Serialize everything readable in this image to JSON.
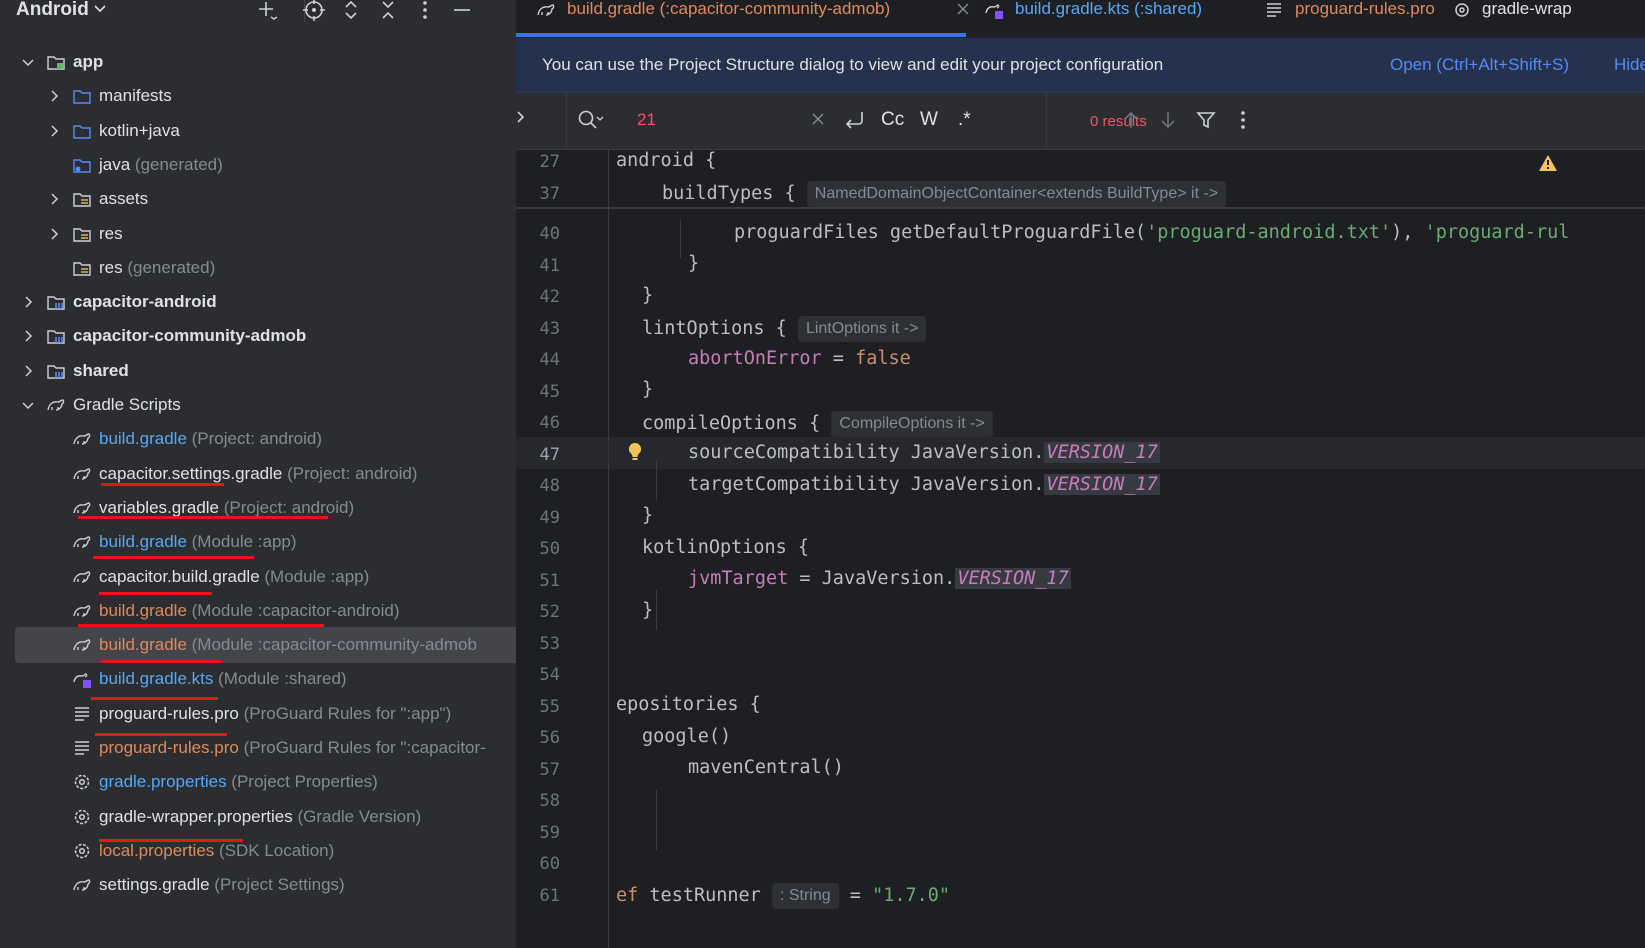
{
  "sidebar": {
    "title": "Android",
    "tree": [
      {
        "label": "app",
        "hint": "",
        "color": "default",
        "bold": true,
        "chevron": "down",
        "icon": "module-folder-icon"
      },
      {
        "label": "manifests",
        "hint": "",
        "color": "default",
        "bold": false,
        "chevron": "right",
        "icon": "folder-icon"
      },
      {
        "label": "kotlin+java",
        "hint": "",
        "color": "default",
        "bold": false,
        "chevron": "right",
        "icon": "folder-icon"
      },
      {
        "label": "java",
        "hint": " (generated)",
        "color": "default",
        "bold": false,
        "chevron": "",
        "icon": "generated-folder-icon"
      },
      {
        "label": "assets",
        "hint": "",
        "color": "default",
        "bold": false,
        "chevron": "right",
        "icon": "resource-folder-icon"
      },
      {
        "label": "res",
        "hint": "",
        "color": "default",
        "bold": false,
        "chevron": "right",
        "icon": "resource-folder-icon"
      },
      {
        "label": "res",
        "hint": " (generated)",
        "color": "default",
        "bold": false,
        "chevron": "",
        "icon": "resource-folder-icon"
      },
      {
        "label": "capacitor-android",
        "hint": "",
        "color": "default",
        "bold": true,
        "chevron": "right",
        "icon": "library-module-icon"
      },
      {
        "label": "capacitor-community-admob",
        "hint": "",
        "color": "default",
        "bold": true,
        "chevron": "right",
        "icon": "library-module-icon"
      },
      {
        "label": "shared",
        "hint": "",
        "color": "default",
        "bold": true,
        "chevron": "right",
        "icon": "library-module-icon"
      },
      {
        "label": "Gradle Scripts",
        "hint": "",
        "color": "default",
        "bold": false,
        "chevron": "down",
        "icon": "gradle-icon"
      },
      {
        "label": "build.gradle",
        "hint": " (Project: android)",
        "color": "blue",
        "bold": false,
        "chevron": "",
        "icon": "gradle-icon"
      },
      {
        "label": "capacitor.settings.gradle",
        "hint": " (Project: android)",
        "color": "default",
        "bold": false,
        "chevron": "",
        "icon": "gradle-icon"
      },
      {
        "label": "variables.gradle",
        "hint": " (Project: android)",
        "color": "default",
        "bold": false,
        "chevron": "",
        "icon": "gradle-icon"
      },
      {
        "label": "build.gradle",
        "hint": " (Module :app)",
        "color": "blue",
        "bold": false,
        "chevron": "",
        "icon": "gradle-icon"
      },
      {
        "label": "capacitor.build.gradle",
        "hint": " (Module :app)",
        "color": "default",
        "bold": false,
        "chevron": "",
        "icon": "gradle-icon"
      },
      {
        "label": "build.gradle",
        "hint": " (Module :capacitor-android)",
        "color": "orange",
        "bold": false,
        "chevron": "",
        "icon": "gradle-icon"
      },
      {
        "label": "build.gradle",
        "hint": " (Module :capacitor-community-admob",
        "color": "orange",
        "bold": false,
        "chevron": "",
        "icon": "gradle-icon",
        "selected": true
      },
      {
        "label": "build.gradle.kts",
        "hint": " (Module :shared)",
        "color": "blue",
        "bold": false,
        "chevron": "",
        "icon": "gradle-kts-icon"
      },
      {
        "label": "proguard-rules.pro",
        "hint": " (ProGuard Rules for \":app\")",
        "color": "default",
        "bold": false,
        "chevron": "",
        "icon": "text-file-icon"
      },
      {
        "label": "proguard-rules.pro",
        "hint": " (ProGuard Rules for \":capacitor-",
        "color": "orange",
        "bold": false,
        "chevron": "",
        "icon": "text-file-icon"
      },
      {
        "label": "gradle.properties",
        "hint": " (Project Properties)",
        "color": "blue",
        "bold": false,
        "chevron": "",
        "icon": "settings-file-icon"
      },
      {
        "label": "gradle-wrapper.properties",
        "hint": " (Gradle Version)",
        "color": "default",
        "bold": false,
        "chevron": "",
        "icon": "settings-file-icon"
      },
      {
        "label": "local.properties",
        "hint": " (SDK Location)",
        "color": "orange",
        "bold": false,
        "chevron": "",
        "icon": "settings-file-icon"
      },
      {
        "label": "settings.gradle",
        "hint": " (Project Settings)",
        "color": "default",
        "bold": false,
        "chevron": "",
        "icon": "gradle-icon"
      }
    ]
  },
  "tabs": [
    {
      "label": "build.gradle (:capacitor-community-admob)",
      "color": "#e0895b",
      "icon": "gradle-icon",
      "active": true
    },
    {
      "label": "build.gradle.kts (:shared)",
      "color": "#56a8f5",
      "icon": "gradle-kts-icon"
    },
    {
      "label": "proguard-rules.pro",
      "color": "#e0895b",
      "icon": "text-file-icon"
    },
    {
      "label": "gradle-wrap",
      "color": "#dfe1e5",
      "icon": "settings-file-icon"
    }
  ],
  "banner": {
    "text": "You can use the Project Structure dialog to view and edit your project configuration",
    "open_link": "Open (Ctrl+Alt+Shift+S)",
    "hide_link": "Hide"
  },
  "find": {
    "query": "21",
    "results": "0 results",
    "opt_case": "Cc",
    "opt_word": "W",
    "opt_regex": ".*"
  },
  "code": {
    "sticky": [
      {
        "n": "27"
      },
      {
        "n": "37",
        "hint": "NamedDomainObjectContainer<extends BuildType> it ->"
      }
    ],
    "lines": [
      {
        "n": "40"
      },
      {
        "n": "41"
      },
      {
        "n": "42"
      },
      {
        "n": "43",
        "hint": "LintOptions it ->"
      },
      {
        "n": "44"
      },
      {
        "n": "45"
      },
      {
        "n": "46",
        "hint": "CompileOptions it ->"
      },
      {
        "n": "47"
      },
      {
        "n": "48"
      },
      {
        "n": "49"
      },
      {
        "n": "50"
      },
      {
        "n": "51"
      },
      {
        "n": "52"
      },
      {
        "n": "53"
      },
      {
        "n": "54"
      },
      {
        "n": "55"
      },
      {
        "n": "56"
      },
      {
        "n": "57"
      },
      {
        "n": "58"
      },
      {
        "n": "59"
      },
      {
        "n": "60"
      },
      {
        "n": "61",
        "hint": ": String"
      }
    ],
    "text": {
      "l27": "android {",
      "l37": "buildTypes {",
      "l40a": "proguardFiles getDefaultProguardFile(",
      "l40b": "'proguard-android.txt'",
      "l40c": "), ",
      "l40d": "'proguard-rul",
      "l41": "}",
      "l42": "}",
      "l43": "lintOptions {",
      "l44a": "abortOnError",
      "l44b": " = ",
      "l44c": "false",
      "l45": "}",
      "l46": "compileOptions {",
      "l47a": "sourceCompatibility JavaVersion.",
      "l47b": "VERSION_17",
      "l48a": "targetCompatibility JavaVersion.",
      "l48b": "VERSION_17",
      "l49": "}",
      "l50": "kotlinOptions {",
      "l51a": "jvmTarget",
      "l51b": " = JavaVersion.",
      "l51c": "VERSION_17",
      "l52": "}",
      "l55": "epositories {",
      "l56": "google()",
      "l57": "mavenCentral()",
      "l61a": "ef",
      "l61b": " testRunner",
      "l61c": " = ",
      "l61d": "\"1.7.0\""
    }
  },
  "colors": {
    "accent": "#3574f0",
    "annotation_underline": "#e8141a",
    "modified_blue": "#56a8f5",
    "unversioned_orange": "#e0895b"
  }
}
